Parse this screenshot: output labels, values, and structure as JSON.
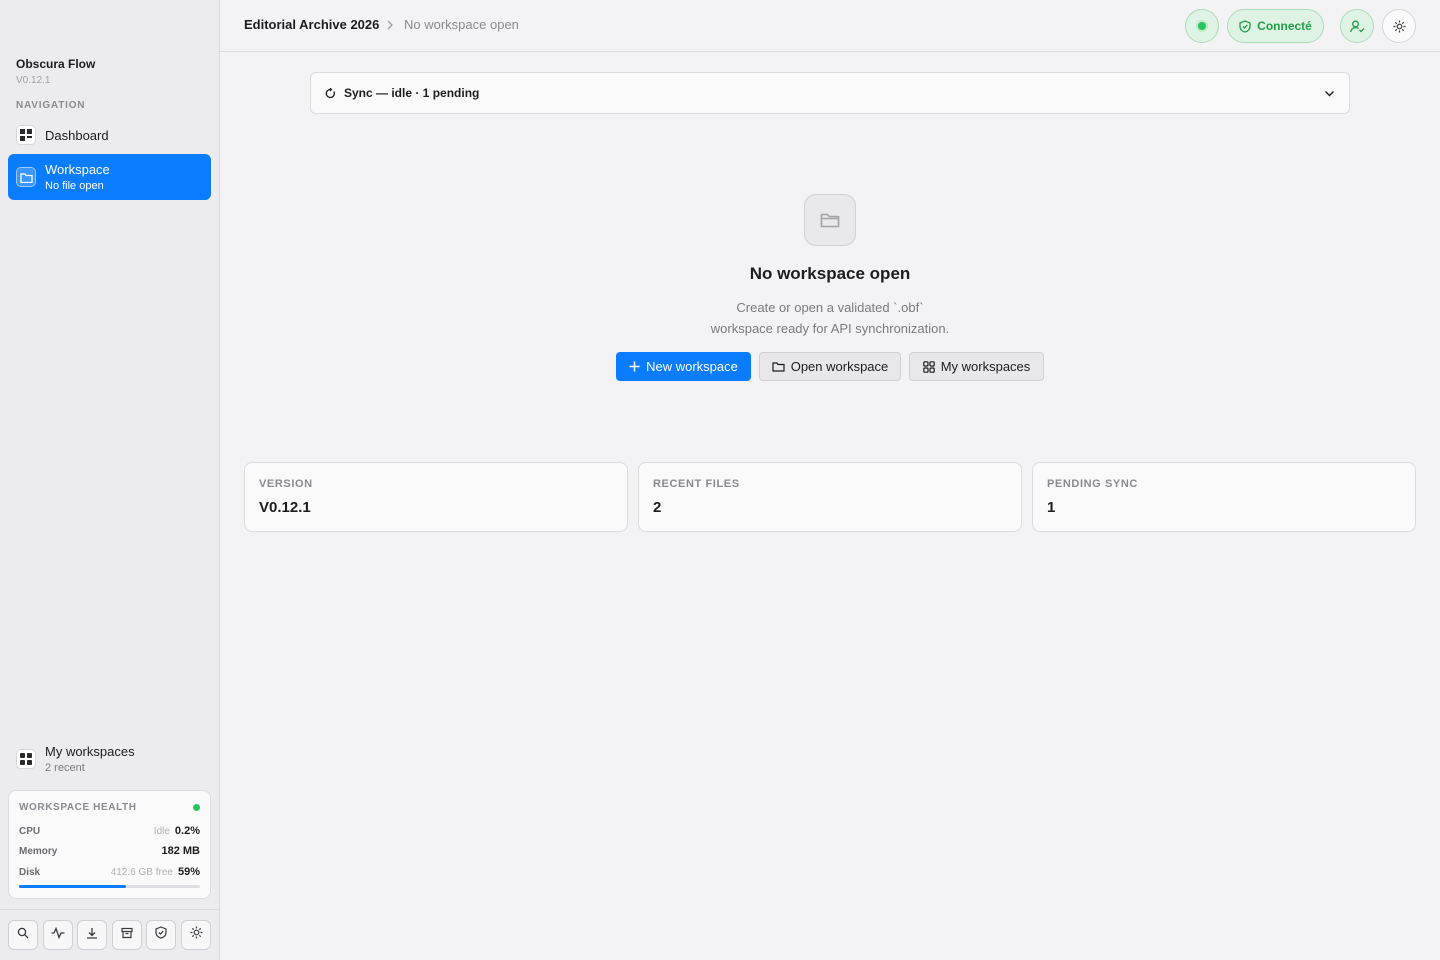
{
  "app": {
    "name": "Obscura Flow",
    "version": "V0.12.1"
  },
  "sidebar": {
    "nav_heading": "NAVIGATION",
    "items": [
      {
        "label": "Dashboard",
        "sub": "",
        "icon": "dashboard-icon",
        "active": false
      },
      {
        "label": "Workspace",
        "sub": "No file open",
        "icon": "folder-icon",
        "active": true
      }
    ],
    "bottom_item": {
      "label": "My workspaces",
      "sub": "2 recent",
      "icon": "grid-icon"
    },
    "health": {
      "title": "WORKSPACE HEALTH",
      "status_color": "#22c55e",
      "cpu": {
        "label": "CPU",
        "note": "Idle",
        "value": "0.2%"
      },
      "memory": {
        "label": "Memory",
        "value": "182 MB"
      },
      "disk": {
        "label": "Disk",
        "note": "412.6 GB free",
        "value": "59%",
        "fraction": 0.59
      }
    },
    "toolbar": [
      "search-icon",
      "activity-icon",
      "download-icon",
      "archive-icon",
      "shield-check-icon",
      "settings-icon"
    ]
  },
  "header": {
    "breadcrumb_root": "Editorial Archive 2026",
    "breadcrumb_current": "No workspace open",
    "status_label": "Connecté",
    "accent": "#0a7cff",
    "status_color": "#22a046"
  },
  "sync": {
    "label": "Sync — idle · 1 pending"
  },
  "empty_state": {
    "title": "No workspace open",
    "desc_line1": "Create or open a validated `.obf`",
    "desc_line2": "workspace ready for API synchronization.",
    "new_btn": "New workspace",
    "open_btn": "Open workspace",
    "my_btn": "My workspaces"
  },
  "stats": [
    {
      "label": "VERSION",
      "value": "V0.12.1"
    },
    {
      "label": "RECENT FILES",
      "value": "2"
    },
    {
      "label": "PENDING SYNC",
      "value": "1"
    }
  ]
}
